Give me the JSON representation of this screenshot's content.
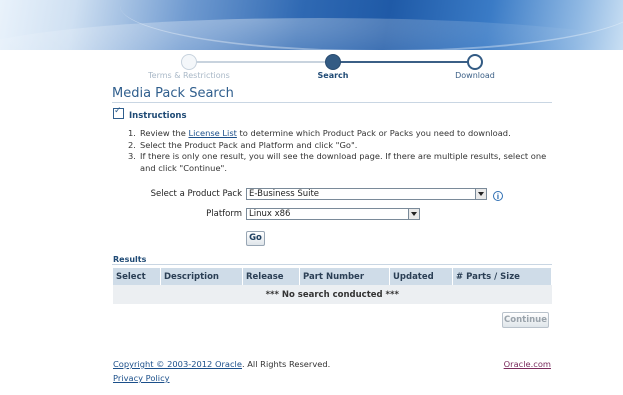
{
  "train": {
    "steps": [
      {
        "label": "Terms & Restrictions",
        "state": "visited"
      },
      {
        "label": "Search",
        "state": "current"
      },
      {
        "label": "Download",
        "state": "upcoming"
      }
    ]
  },
  "page": {
    "title": "Media Pack Search"
  },
  "instructions": {
    "heading": "Instructions",
    "steps": [
      {
        "num": "1.",
        "pre": "Review the ",
        "link": "License List",
        "post": " to determine which Product Pack or Packs you need to download."
      },
      {
        "num": "2.",
        "text": "Select the Product Pack and Platform and click \"Go\"."
      },
      {
        "num": "3.",
        "text": "If there is only one result, you will see the download page. If there are multiple results, select one and click \"Continue\"."
      }
    ]
  },
  "form": {
    "product_pack_label": "Select a Product Pack",
    "product_pack_value": "E-Business Suite",
    "platform_label": "Platform",
    "platform_value": "Linux x86",
    "go_label": "Go"
  },
  "results": {
    "label": "Results",
    "columns": [
      "Select",
      "Description",
      "Release",
      "Part Number",
      "Updated",
      "# Parts / Size"
    ],
    "empty_message": "*** No search conducted ***",
    "continue_label": "Continue"
  },
  "footer": {
    "copyright_link": "Copyright © 2003-2012 Oracle",
    "copyright_rest": ". All Rights Reserved.",
    "privacy": "Privacy Policy",
    "oracle_link": "Oracle.com"
  },
  "colors": {
    "accent": "#2f5e8d",
    "train_active": "#335b84",
    "header_bg": "#cfdce8"
  }
}
